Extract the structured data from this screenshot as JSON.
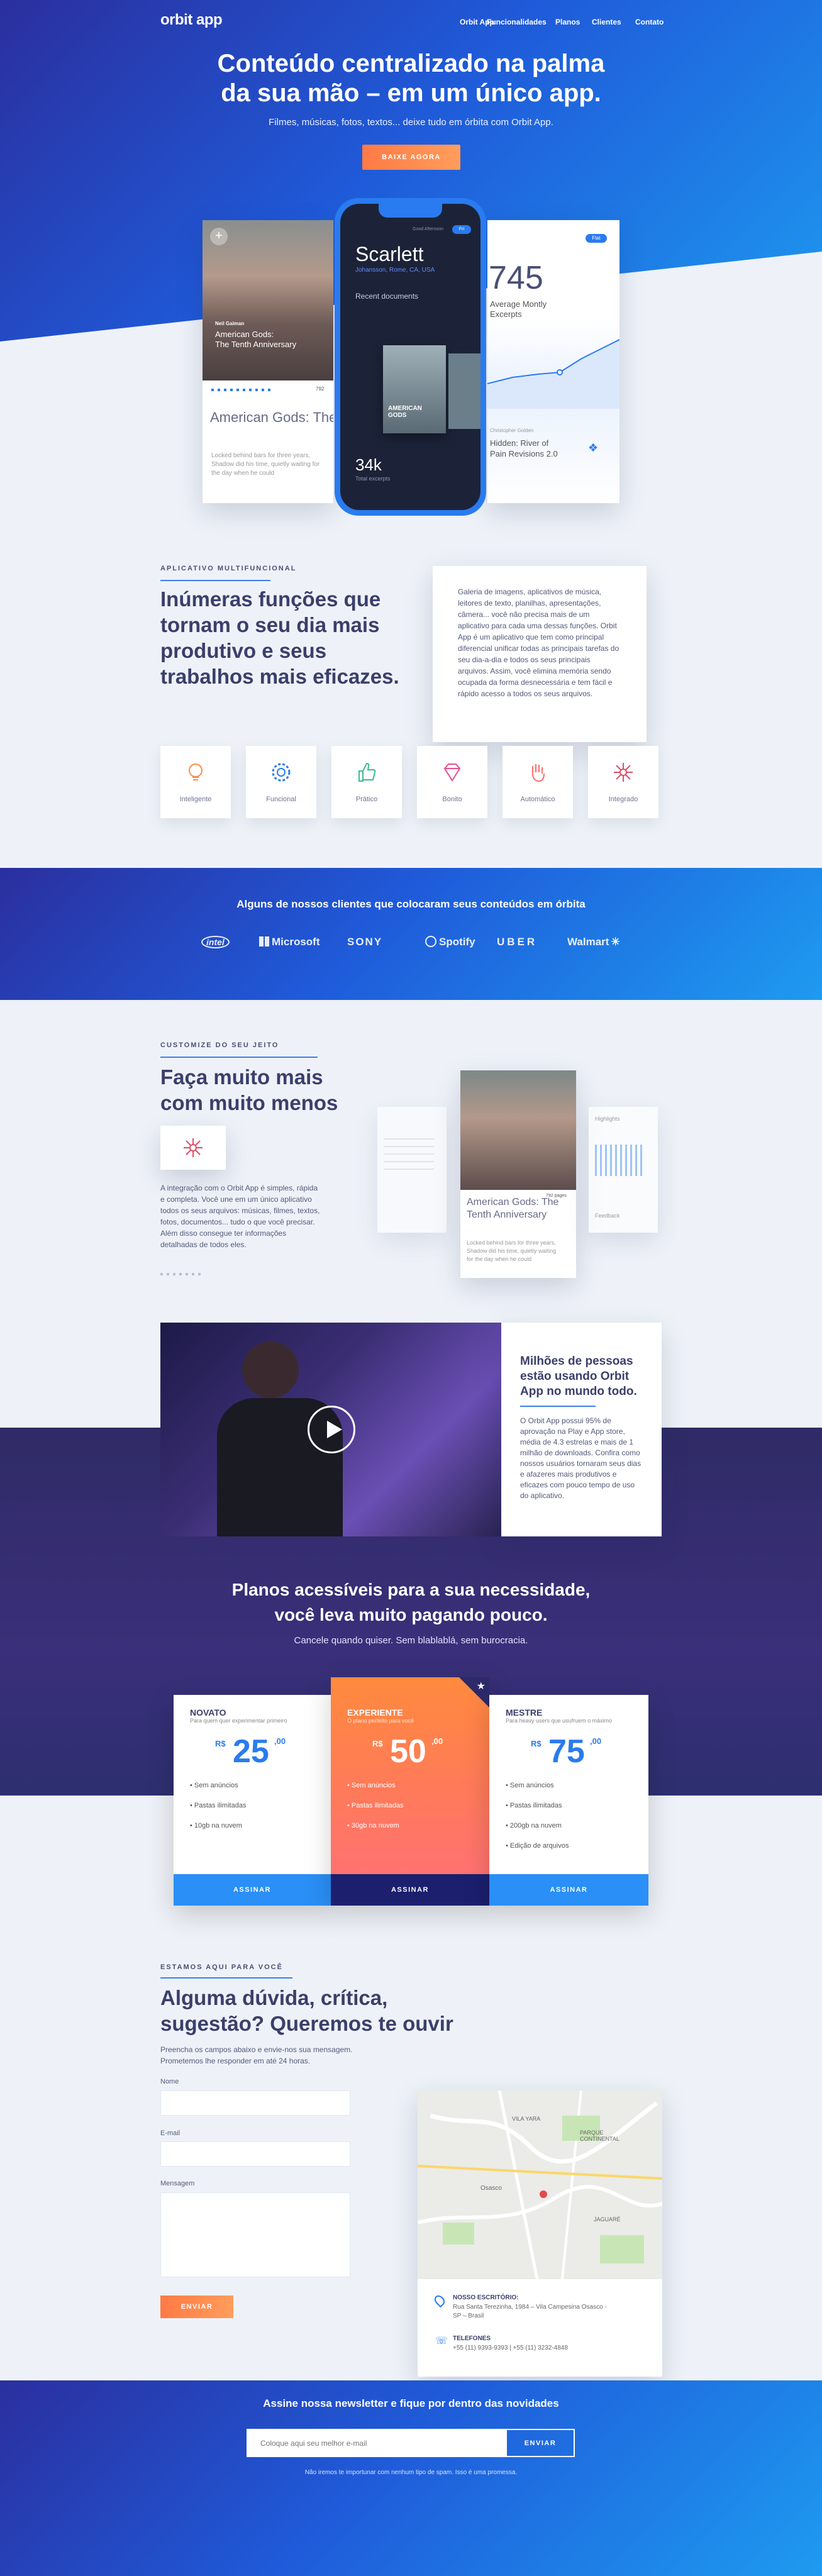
{
  "header": {
    "logo": "orbit app",
    "nav": [
      "Orbit App",
      "Funcionalidades",
      "Planos",
      "Clientes",
      "Contato"
    ]
  },
  "hero": {
    "title_line1": "Conteúdo centralizado na palma",
    "title_line2": "da sua mão – em um único app.",
    "subtitle": "Filmes, músicas, fotos, textos... deixe tudo em órbita com Orbit App.",
    "cta": "BAIXE AGORA"
  },
  "mockups": {
    "left_author": "Neil Gaiman",
    "left_title": "American Gods:\nThe Tenth Anniversary",
    "left_title_big": "American Gods: The Tenth Anniversa",
    "left_pages": "792",
    "left_excerpt": "Locked behind bars for three years, Shadow did his time, quietly waiting for the day when he could",
    "phone_header": "Good Afternoon",
    "phone_badge": "Fri",
    "phone_name": "Scarlett",
    "phone_surname": "Johansson, Rome, CA, USA",
    "phone_recent": "Recent documents",
    "phone_book": "AMERICAN GODS",
    "phone_count": "34k",
    "phone_count_label": "Total excerpts",
    "right_number": "745",
    "right_label": "Average Montly Excerpts",
    "right_author": "Christopher Golden",
    "right_title": "Hidden: River of Pain Revisions 2.0",
    "right_badge": "Flat"
  },
  "features": {
    "eyebrow": "APLICATIVO MULTIFUNCIONAL",
    "title": "Inúmeras funções que tornam o seu dia mais produtivo e seus trabalhos mais eficazes.",
    "description": "Galeria de imagens, aplicativos de música, leitores de texto, planilhas, apresentações, câmera... você não precisa mais de um aplicativo para cada uma dessas funções. Orbit App é um aplicativo que tem como principal diferencial unificar todas as principais tarefas do seu dia-a-dia e todos os seus principais arquivos. Assim, você elimina memória sendo ocupada da forma desnecessária e tem fácil e rápido acesso a todos os seus arquivos.",
    "items": [
      "Inteligente",
      "Funcional",
      "Prático",
      "Bonito",
      "Automático",
      "Integrado"
    ]
  },
  "clients": {
    "title": "Alguns de nossos clientes que colocaram seus conteúdos em órbita",
    "logos": [
      "intel",
      "Microsoft",
      "SONY",
      "Spotify",
      "UBER",
      "Walmart"
    ]
  },
  "customize": {
    "eyebrow": "CUSTOMIZE DO SEU JEITO",
    "title": "Faça muito mais com muito menos",
    "description": "A integração com o Orbit App é simples, rápida e completa. Você une em um único aplicativo todos os seus arquivos: músicas, filmes, textos, fotos, documentos... tudo o que você precisar. Além disso consegue ter informações detalhadas de todos eles.",
    "card_title": "American Gods: The Tenth Anniversary",
    "card_pages": "792 pages",
    "card_excerpt": "Locked behind bars for three years, Shadow did his time, quietly waiting for the day when he could",
    "side_label1": "Highlights",
    "side_label2": "Feedback"
  },
  "video": {
    "title": "Milhões de pessoas estão usando Orbit App no mundo todo.",
    "description": "O Orbit App possui 95% de aprovação na Play e App store, média de 4.3 estrelas e mais de 1 milhão de downloads. Confira como nossos usuários tornaram seus dias e afazeres mais produtivos e eficazes com pouco tempo de uso do aplicativo."
  },
  "pricing": {
    "title_line1": "Planos acessíveis para a sua necessidade,",
    "title_line2": "você leva muito pagando pouco.",
    "subtitle": "Cancele quando quiser. Sem blablablá, sem burocracia.",
    "currency": "R$",
    "plans": [
      {
        "name": "NOVATO",
        "desc": "Para quem quer experimentar primeiro",
        "amount": "25",
        "cents": ",00",
        "features": [
          "Sem anúncios",
          "Pastas ilimitadas",
          "10gb na nuvem"
        ],
        "button": "ASSINAR"
      },
      {
        "name": "EXPERIENTE",
        "desc": "O plano perfeito para você",
        "amount": "50",
        "cents": ",00",
        "features": [
          "Sem anúncios",
          "Pastas ilimitadas",
          "30gb na nuvem"
        ],
        "button": "ASSINAR"
      },
      {
        "name": "MESTRE",
        "desc": "Para heavy users que usufruem o máximo",
        "amount": "75",
        "cents": ",00",
        "features": [
          "Sem anúncios",
          "Pastas ilimitadas",
          "200gb na nuvem",
          "Edição de arquivos"
        ],
        "button": "ASSINAR"
      }
    ]
  },
  "contact": {
    "eyebrow": "ESTAMOS AQUI PARA VOCÊ",
    "title": "Alguma dúvida, crítica, sugestão? Queremos te ouvir",
    "subtitle": "Preencha os campos abaixo e envie-nos sua mensagem. Prometemos lhe responder em até 24 horas.",
    "label_name": "Nome",
    "label_email": "E-mail",
    "label_message": "Mensagem",
    "submit": "ENVIAR",
    "office_title": "NOSSO ESCRITÓRIO:",
    "office_address": "Rua Santa Terezinha, 1984 – Vila Campesina Osasco - SP – Brasil",
    "phones_title": "TELEFONES",
    "phones": "+55 (11) 9393-9393 | +55 (11) 3232-4848",
    "map_labels": [
      "PARQUE CONTINENTAL",
      "VILA YARA",
      "JAGUARÉ",
      "Osasco"
    ]
  },
  "newsletter": {
    "title": "Assine nossa newsletter e fique por dentro das novidades",
    "placeholder": "Coloque aqui seu melhor e-mail",
    "button": "ENVIAR",
    "note": "Não iremos te importunar com nenhum tipo de spam. Isso é uma promessa."
  }
}
